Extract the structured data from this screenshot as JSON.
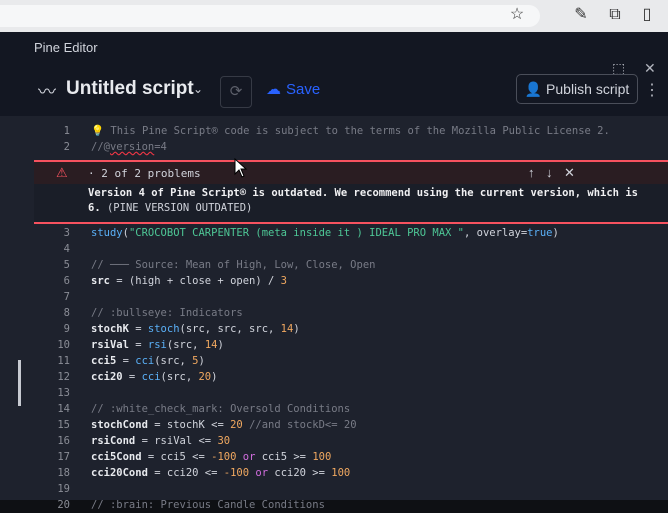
{
  "browser": {
    "star_icon": "star-icon",
    "tab_icons": [
      "edit-icon",
      "extensions-icon",
      "sidebar-icon"
    ]
  },
  "panel": {
    "title": "Pine Editor",
    "window_icons": [
      "maximize-icon",
      "close-icon",
      "more-icon"
    ]
  },
  "toolbar": {
    "script_name": "Untitled script",
    "save_label": "Save",
    "publish_label": "Publish script"
  },
  "problems": {
    "counter": "2 of 2 problems",
    "message": "Version 4 of Pine Script® is outdated. We recommend using the current version, which is 6.",
    "code": "(PINE VERSION OUTDATED)"
  },
  "code_lines": [
    {
      "n": "1",
      "text": "💡 This Pine Script® code is subject to the terms of the Mozilla Public License 2."
    },
    {
      "n": "2",
      "text": "//@version=4"
    },
    {
      "n": "3",
      "text": "study(\"CROCOBOT CARPENTER (meta inside it ) IDEAL PRO MAX \", overlay=true)"
    },
    {
      "n": "4",
      "text": ""
    },
    {
      "n": "5",
      "text": "// ─── Source: Mean of High, Low, Close, Open"
    },
    {
      "n": "6",
      "text": "src = (high + close + open) / 3"
    },
    {
      "n": "7",
      "text": ""
    },
    {
      "n": "8",
      "text": "// :bullseye: Indicators"
    },
    {
      "n": "9",
      "text": "stochK = stoch(src, src, src, 14)"
    },
    {
      "n": "10",
      "text": "rsiVal = rsi(src, 14)"
    },
    {
      "n": "11",
      "text": "cci5 = cci(src, 5)"
    },
    {
      "n": "12",
      "text": "cci20 = cci(src, 20)"
    },
    {
      "n": "13",
      "text": ""
    },
    {
      "n": "14",
      "text": "// :white_check_mark: Oversold Conditions"
    },
    {
      "n": "15",
      "text": "stochCond = stochK <= 20 //and stockD<= 20"
    },
    {
      "n": "16",
      "text": "rsiCond = rsiVal <= 30"
    },
    {
      "n": "17",
      "text": "cci5Cond = cci5 <= -100 or cci5 >= 100"
    },
    {
      "n": "18",
      "text": "cci20Cond = cci20 <= -100 or cci20 >= 100"
    },
    {
      "n": "19",
      "text": ""
    },
    {
      "n": "20",
      "text": "// :brain: Previous Candle Conditions"
    }
  ]
}
